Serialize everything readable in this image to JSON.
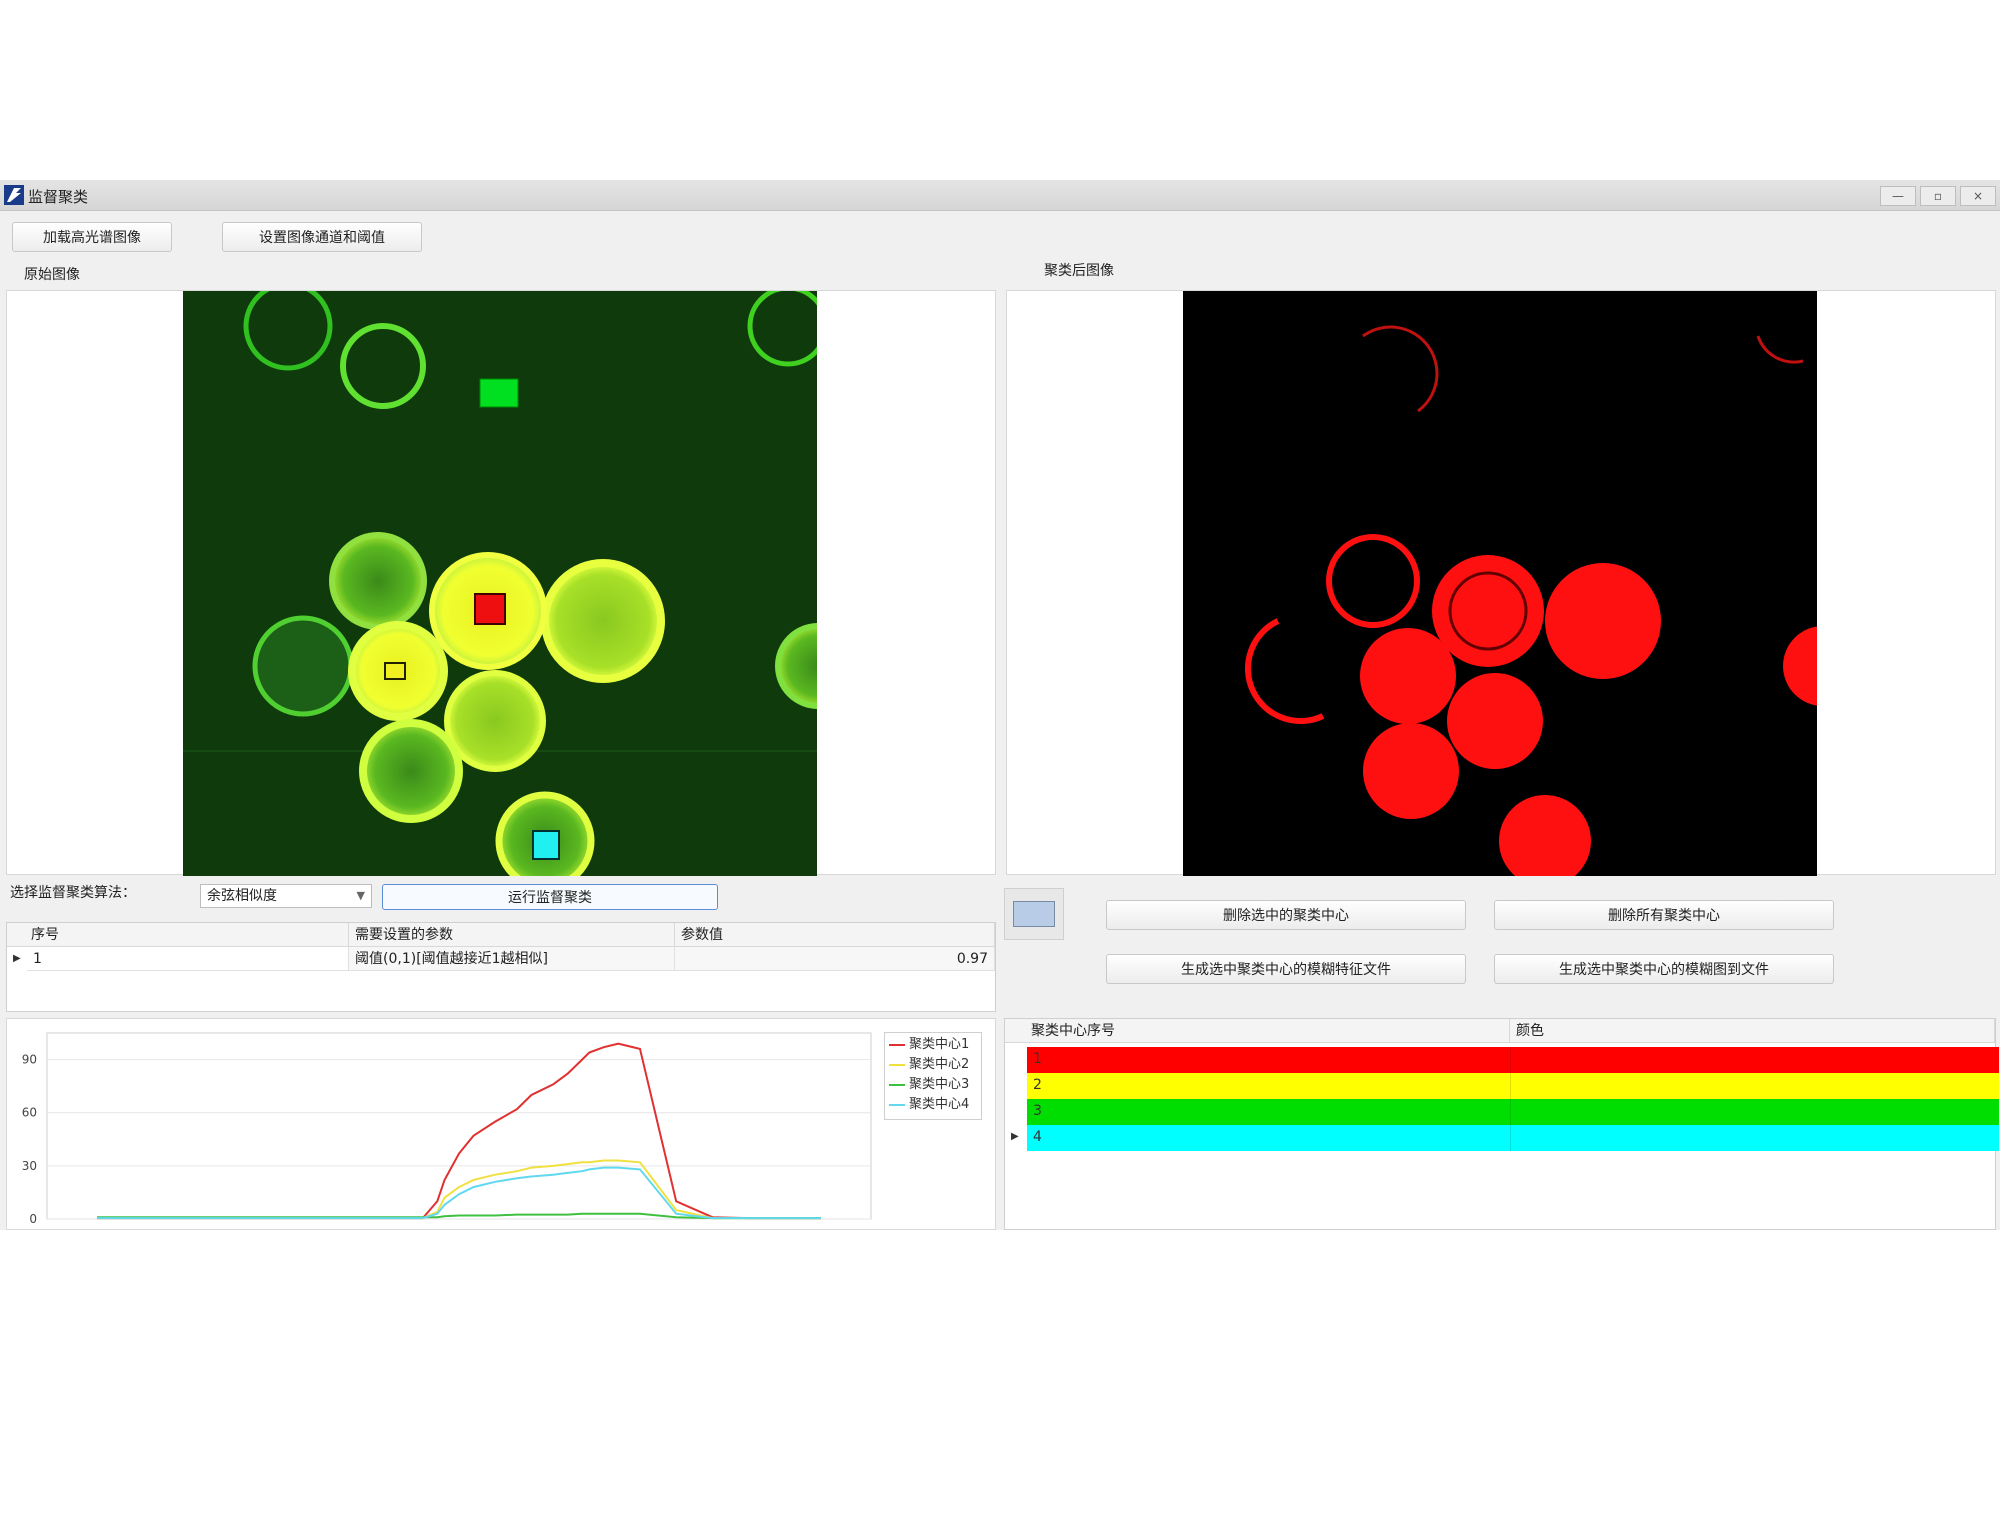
{
  "window": {
    "title": "监督聚类",
    "controls": {
      "minimize": "—",
      "restore": "▫",
      "close": "×"
    }
  },
  "toolbar": {
    "load_button": "加载高光谱图像",
    "set_channel_button": "设置图像通道和阈值"
  },
  "left_panel": {
    "label": "原始图像"
  },
  "right_panel": {
    "label": "聚类后图像"
  },
  "algorithm": {
    "label": "选择监督聚类算法：",
    "selected": "余弦相似度",
    "run_button": "运行监督聚类"
  },
  "param_table": {
    "columns": [
      "序号",
      "需要设置的参数",
      "参数值"
    ],
    "rows": [
      {
        "index": "1",
        "param": "阈值(0,1)[阈值越接近1越相似]",
        "value": "0.97"
      }
    ]
  },
  "actions": {
    "delete_selected": "删除选中的聚类中心",
    "delete_all": "删除所有聚类中心",
    "gen_feature_file": "生成选中聚类中心的模糊特征文件",
    "gen_image_file": "生成选中聚类中心的模糊图到文件"
  },
  "center_table": {
    "columns": [
      "聚类中心序号",
      "颜色"
    ],
    "rows": [
      {
        "index": "1",
        "color": "#ff0000"
      },
      {
        "index": "2",
        "color": "#ffff00"
      },
      {
        "index": "3",
        "color": "#00dd00"
      },
      {
        "index": "4",
        "color": "#00ffff"
      }
    ]
  },
  "chart_data": {
    "type": "line",
    "ylim": [
      0,
      105
    ],
    "yticks": [
      "0",
      "30",
      "60",
      "90"
    ],
    "x": [
      0,
      5,
      10,
      15,
      20,
      25,
      30,
      35,
      40,
      45,
      47,
      48,
      50,
      52,
      55,
      58,
      60,
      63,
      65,
      67,
      68,
      70,
      72,
      75,
      80,
      85,
      90,
      95,
      100
    ],
    "series": [
      {
        "name": "聚类中心1",
        "color": "#e03030",
        "values": [
          0.5,
          0.5,
          0.5,
          0.5,
          0.5,
          0.5,
          0.5,
          0.5,
          0.5,
          0.5,
          10,
          22,
          37,
          47,
          55,
          62,
          70,
          76,
          82,
          90,
          94,
          97,
          99,
          96,
          10,
          1,
          0.5,
          0.5,
          0.5
        ]
      },
      {
        "name": "聚类中心2",
        "color": "#f0e040",
        "values": [
          0.5,
          0.5,
          0.5,
          0.5,
          0.5,
          0.5,
          0.5,
          0.5,
          0.5,
          0.5,
          4,
          12,
          18,
          22,
          25,
          27,
          29,
          30,
          31,
          32,
          32,
          33,
          33,
          32,
          5,
          0.5,
          0.5,
          0.5,
          0.5
        ]
      },
      {
        "name": "聚类中心3",
        "color": "#40c040",
        "values": [
          1,
          1,
          1,
          1,
          1,
          1,
          1,
          1,
          1,
          1,
          1,
          1.5,
          2,
          2,
          2,
          2.5,
          2.5,
          2.5,
          2.5,
          3,
          3,
          3,
          3,
          3,
          1,
          0.5,
          0.5,
          0.5,
          0.5
        ]
      },
      {
        "name": "聚类中心4",
        "color": "#60d8f0",
        "values": [
          0.5,
          0.5,
          0.5,
          0.5,
          0.5,
          0.5,
          0.5,
          0.5,
          0.5,
          0.5,
          3,
          8,
          14,
          18,
          21,
          23,
          24,
          25,
          26,
          27,
          28,
          29,
          29,
          28,
          3,
          0.5,
          0.5,
          0.5,
          0.5
        ]
      }
    ]
  }
}
